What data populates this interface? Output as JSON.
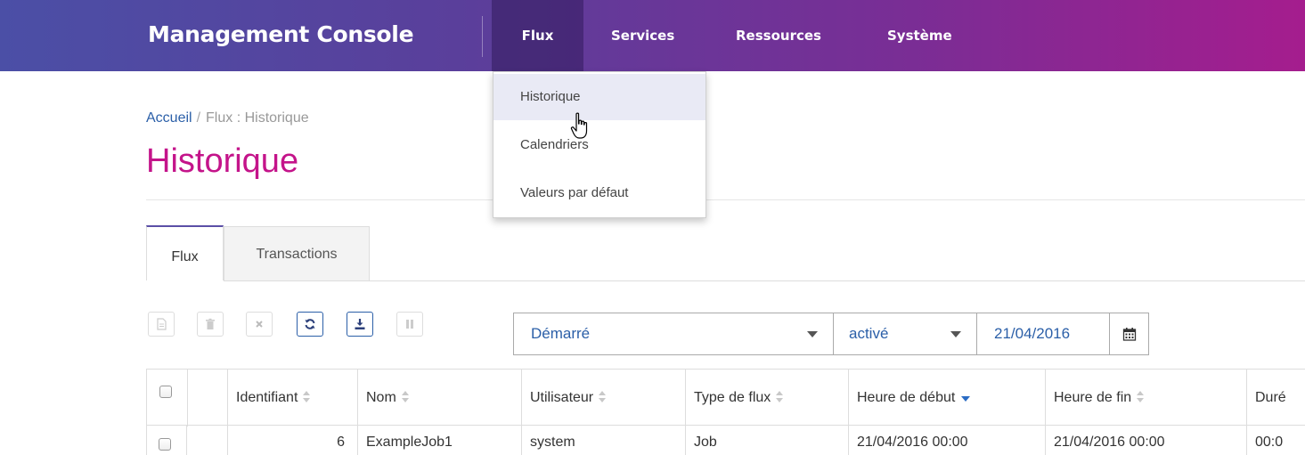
{
  "app": {
    "title": "Management Console"
  },
  "nav": {
    "items": [
      {
        "label": "Flux"
      },
      {
        "label": "Services"
      },
      {
        "label": "Ressources"
      },
      {
        "label": "Système"
      }
    ],
    "active": "Flux"
  },
  "dropdown": {
    "items": [
      {
        "label": "Historique"
      },
      {
        "label": "Calendriers"
      },
      {
        "label": "Valeurs par défaut"
      }
    ],
    "hovered": "Historique"
  },
  "breadcrumb": {
    "home": "Accueil",
    "separator": "/",
    "current": "Flux : Historique"
  },
  "page": {
    "title": "Historique"
  },
  "tabs": [
    {
      "label": "Flux"
    },
    {
      "label": "Transactions"
    }
  ],
  "toolbar": {
    "buttons": [
      {
        "icon": "document-icon",
        "enabled": false
      },
      {
        "icon": "trash-icon",
        "enabled": false
      },
      {
        "icon": "close-icon",
        "enabled": false
      },
      {
        "icon": "refresh-icon",
        "enabled": true
      },
      {
        "icon": "download-icon",
        "enabled": true
      },
      {
        "icon": "pause-icon",
        "enabled": false
      }
    ]
  },
  "filters": {
    "status": "Démarré",
    "activation": "activé",
    "date": "21/04/2016"
  },
  "table": {
    "headers": [
      "Identifiant",
      "Nom",
      "Utilisateur",
      "Type de flux",
      "Heure de début",
      "Heure de fin",
      "Duré"
    ],
    "rows": [
      {
        "id": "6",
        "name": "ExampleJob1",
        "user": "system",
        "type": "Job",
        "start": "21/04/2016 00:00",
        "end": "21/04/2016 00:00",
        "duration": "00:0"
      }
    ]
  },
  "colors": {
    "accent": "#c4148a",
    "link": "#2b5fa8",
    "nav_start": "#4b4fa6",
    "nav_end": "#a51d8e"
  }
}
